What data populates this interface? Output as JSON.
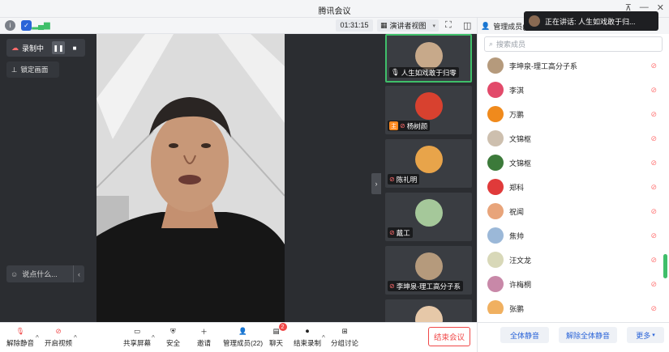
{
  "window": {
    "title": "腾讯会议"
  },
  "toolbar": {
    "timer": "01:31:15",
    "view_label": "演讲者视图"
  },
  "stage": {
    "recording_label": "录制中",
    "lock_label": "锁定画面",
    "say_placeholder": "说点什么..."
  },
  "thumbnails": [
    {
      "name": "人生如戏敢于归零",
      "avatar_color": "#c7a98a",
      "host": false,
      "mic_off": false,
      "active": true
    },
    {
      "name": "杨树颜",
      "avatar_color": "#d8412f",
      "host": true,
      "mic_off": true,
      "active": false
    },
    {
      "name": "陈礼明",
      "avatar_color": "#e8a44a",
      "host": false,
      "mic_off": true,
      "active": false
    },
    {
      "name": "戴工",
      "avatar_color": "#a5c89a",
      "host": false,
      "mic_off": true,
      "active": false
    },
    {
      "name": "李坤泉-理工高分子系",
      "avatar_color": "#b59a7c",
      "host": false,
      "mic_off": true,
      "active": false
    },
    {
      "name": "",
      "avatar_color": "#e6c8a8",
      "host": false,
      "mic_off": false,
      "active": false
    }
  ],
  "bottombar": {
    "unmute": "解除静音",
    "start_video": "开启视频",
    "share_screen": "共享屏幕",
    "security": "安全",
    "invite": "邀请",
    "members": "管理成员(22)",
    "chat": "聊天",
    "chat_badge": "2",
    "end_record": "结束录制",
    "breakout": "分组讨论",
    "end_meeting": "结束会议"
  },
  "members_panel": {
    "header": "管理成员(22",
    "speaking": "正在讲话: 人生如戏敢于归...",
    "search_placeholder": "搜索成员",
    "items": [
      {
        "name": "李坤泉-理工高分子系",
        "avatar_color": "#b59a7c"
      },
      {
        "name": "李淇",
        "avatar_color": "#e24a6a"
      },
      {
        "name": "万鹏",
        "avatar_color": "#f08a1c"
      },
      {
        "name": "文锦枢",
        "avatar_color": "#cdbfae"
      },
      {
        "name": "文锦枢",
        "avatar_color": "#3c7a3a"
      },
      {
        "name": "郑科",
        "avatar_color": "#e03a3a"
      },
      {
        "name": "祝闻",
        "avatar_color": "#e8a47a"
      },
      {
        "name": "焦帅",
        "avatar_color": "#9bb8d8"
      },
      {
        "name": "汪文龙",
        "avatar_color": "#d8d8b8"
      },
      {
        "name": "许梅桐",
        "avatar_color": "#c888a8"
      },
      {
        "name": "张鹏",
        "avatar_color": "#f0b060"
      }
    ],
    "mute_all": "全体静音",
    "unmute_all": "解除全体静音",
    "more": "更多"
  },
  "colors": {
    "accent_green": "#3fbf6a",
    "end_red": "#f04848",
    "link_blue": "#2a64d8"
  }
}
